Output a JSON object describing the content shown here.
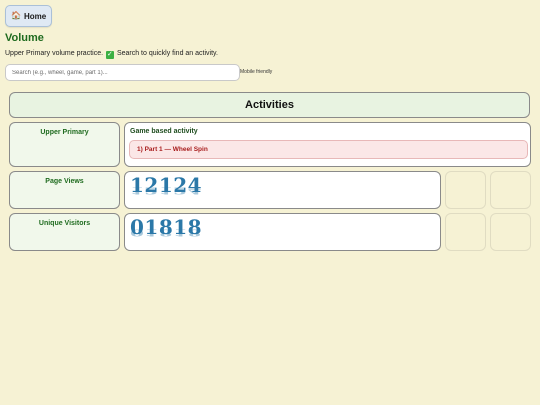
{
  "nav": {
    "home_icon": "🏠",
    "home_label": "Home"
  },
  "page": {
    "title": "Volume",
    "subtitle_before": "Upper Primary volume practice.",
    "check_icon": "✓",
    "subtitle_after": "Search to quickly find an activity.",
    "mobile_label": "Mobile friendly"
  },
  "search": {
    "placeholder": "Search (e.g., wheel, game, part 1)..."
  },
  "activities": {
    "header": "Activities",
    "level_label": "Upper Primary",
    "group_title": "Game based activity",
    "items": [
      {
        "label": "1) Part 1 — Wheel Spin"
      }
    ]
  },
  "stats": {
    "page_views_label": "Page Views",
    "page_views_value": "12124",
    "unique_visitors_label": "Unique Visitors",
    "unique_visitors_value": "01818"
  },
  "colors": {
    "background": "#f6f2d4",
    "accent_green": "#1f6b1f",
    "counter_blue": "#2b78a8",
    "item_red": "#a81c1c"
  }
}
